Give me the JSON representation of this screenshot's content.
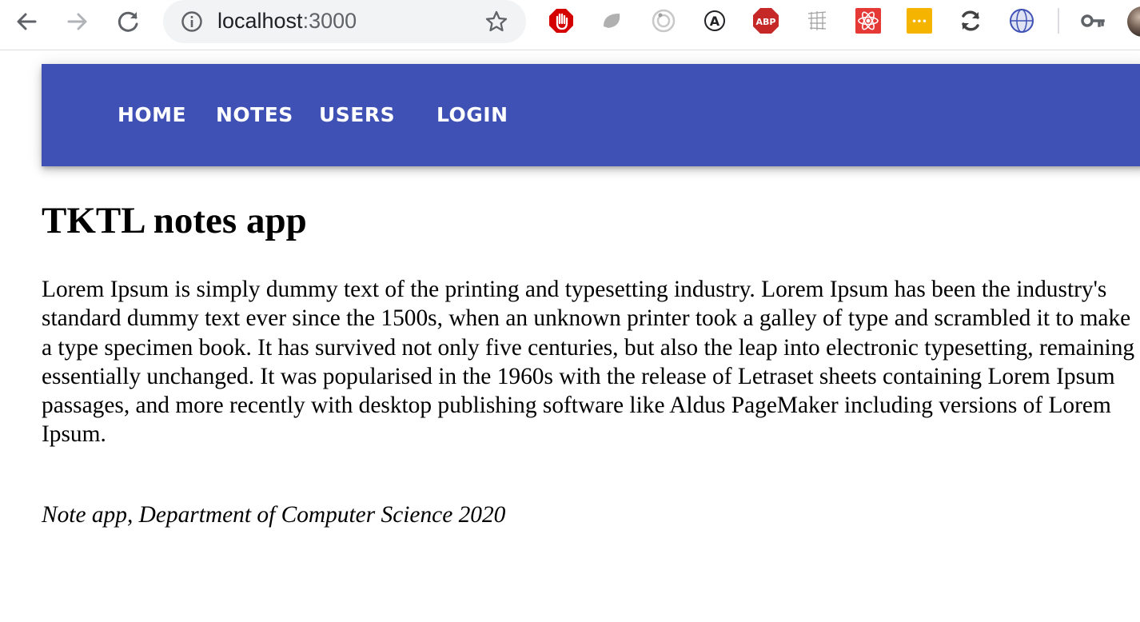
{
  "browser": {
    "url_host": "localhost",
    "url_port": ":3000",
    "icons": {
      "back": "back-arrow-icon",
      "forward": "forward-arrow-icon",
      "reload": "reload-icon",
      "site_info": "info-icon",
      "bookmark": "star-icon",
      "password": "key-icon"
    },
    "extensions": [
      {
        "name": "stop-hand-extension-icon",
        "color": "#d50000"
      },
      {
        "name": "grey-leaf-extension-icon",
        "color": "#9e9e9e"
      },
      {
        "name": "target-extension-icon",
        "color": "#bdbdbd"
      },
      {
        "name": "a-circle-extension-icon",
        "color": "#202124"
      },
      {
        "name": "adblock-plus-extension-icon",
        "color": "#c62828",
        "text": "ABP"
      },
      {
        "name": "grid-sketch-extension-icon",
        "color": "#9e9e9e"
      },
      {
        "name": "react-devtools-extension-icon",
        "color": "#e53935"
      },
      {
        "name": "lastpass-extension-icon",
        "color": "#f4b400",
        "text": "•••"
      },
      {
        "name": "sync-extension-icon",
        "color": "#424242"
      },
      {
        "name": "globe-extension-icon",
        "color": "#3f51b5"
      }
    ]
  },
  "nav": {
    "home": "HOME",
    "notes": "NOTES",
    "users": "USERS",
    "login": "LOGIN",
    "bar_color": "#3f51b5"
  },
  "main": {
    "title": "TKTL notes app",
    "paragraph": "Lorem Ipsum is simply dummy text of the printing and typesetting industry. Lorem Ipsum has been the industry's standard dummy text ever since the 1500s, when an unknown printer took a galley of type and scrambled it to make a type specimen book. It has survived not only five centuries, but also the leap into electronic typesetting, remaining essentially unchanged. It was popularised in the 1960s with the release of Letraset sheets containing Lorem Ipsum passages, and more recently with desktop publishing software like Aldus PageMaker including versions of Lorem Ipsum."
  },
  "footer": {
    "text": "Note app, Department of Computer Science 2020"
  }
}
